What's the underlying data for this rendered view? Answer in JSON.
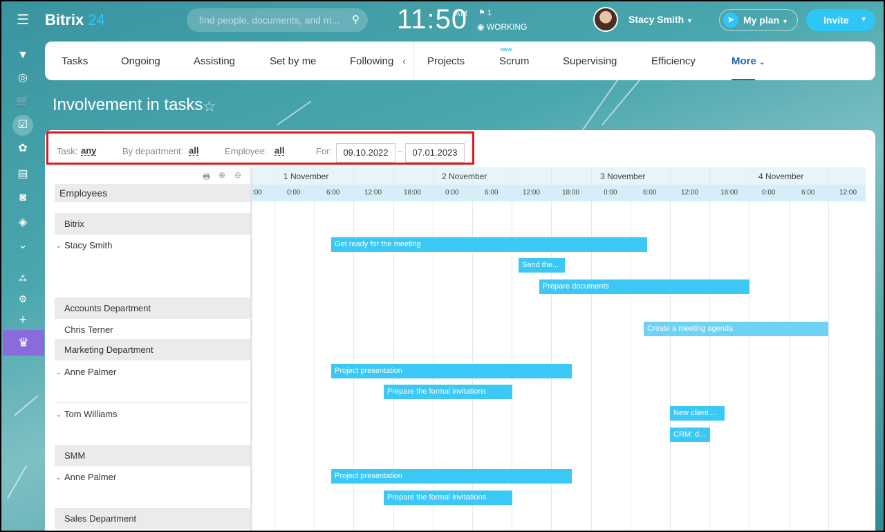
{
  "header": {
    "logo_main": "Bitrix",
    "logo_num": "24",
    "search_placeholder": "find people, documents, and m...",
    "time": "11:50",
    "ampm": "AM",
    "flag_count": "1",
    "status": "WORKING",
    "user_name": "Stacy Smith",
    "plan_label": "My plan",
    "invite_label": "Invite"
  },
  "tabs": {
    "items": [
      "Tasks",
      "Ongoing",
      "Assisting",
      "Set by me",
      "Following",
      "Projects",
      "Scrum",
      "Supervising",
      "Efficiency",
      "More"
    ],
    "new_badge": "NEW",
    "active": "More"
  },
  "page": {
    "title": "Involvement in tasks"
  },
  "filters": {
    "task_label": "Task:",
    "task_value": "any",
    "dept_label": "By department:",
    "dept_value": "all",
    "employee_label": "Employee:",
    "employee_value": "all",
    "for_label": "For:",
    "date_from": "09.10.2022",
    "date_sep": "–",
    "date_to": "07.01.2023"
  },
  "list": {
    "header": "Employees",
    "rows": [
      {
        "kind": "department",
        "label": "Bitrix"
      },
      {
        "kind": "employee",
        "label": "Stacy Smith",
        "expandable": true
      },
      {
        "kind": "department",
        "label": "Accounts Department"
      },
      {
        "kind": "employee",
        "label": "Chris Terner",
        "expandable": false
      },
      {
        "kind": "department",
        "label": "Marketing Department"
      },
      {
        "kind": "employee",
        "label": "Anne Palmer",
        "expandable": true
      },
      {
        "kind": "employee",
        "label": "Tom Williams",
        "expandable": true
      },
      {
        "kind": "department",
        "label": "SMM"
      },
      {
        "kind": "employee",
        "label": "Anne Palmer",
        "expandable": true
      },
      {
        "kind": "department",
        "label": "Sales Department"
      }
    ]
  },
  "gantt": {
    "days": [
      "1 November",
      "2 November",
      "3 November",
      "4 November"
    ],
    "hours": [
      ":00",
      "0:00",
      "6:00",
      "12:00",
      "18:00",
      "0:00",
      "6:00",
      "12:00",
      "18:00",
      "0:00",
      "6:00",
      "12:00",
      "18:00",
      "0:00",
      "6:00",
      "12:00"
    ],
    "tasks": [
      {
        "name": "Get ready for the meeting",
        "owner": "Stacy Smith"
      },
      {
        "name": "Send the...",
        "owner": "Stacy Smith"
      },
      {
        "name": "Prepare documents",
        "owner": "Stacy Smith"
      },
      {
        "name": "Create a meeting agenda",
        "owner": "Chris Terner"
      },
      {
        "name": "Project presentation",
        "owner": "Anne Palmer"
      },
      {
        "name": "Prepare the formal invitations",
        "owner": "Anne Palmer"
      },
      {
        "name": "New client ...",
        "owner": "Tom Williams"
      },
      {
        "name": "CRM: d...",
        "owner": "Tom Williams"
      },
      {
        "name": "Project presentation",
        "owner": "Anne Palmer (SMM)"
      },
      {
        "name": "Prepare the formal invitations",
        "owner": "Anne Palmer (SMM)"
      }
    ]
  },
  "colors": {
    "accent": "#2fc6f6",
    "highlight_border": "#e0161e",
    "bar": "#3bc8f5",
    "link": "#2067b0"
  }
}
